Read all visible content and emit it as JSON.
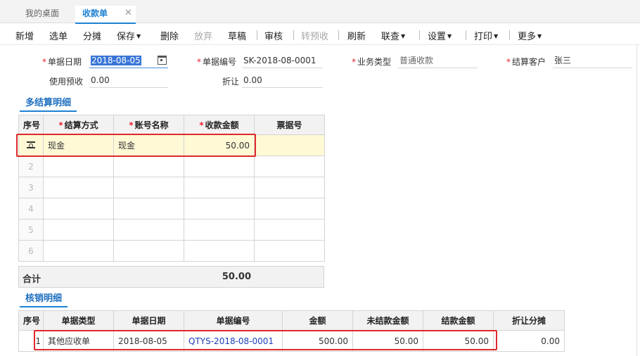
{
  "tabs": [
    {
      "label": "我的桌面"
    },
    {
      "label": "收款单",
      "close": "✕"
    }
  ],
  "toolbar": {
    "new": "新增",
    "select": "选单",
    "split": "分摊",
    "save": "保存",
    "delete": "删除",
    "abandon": "放弃",
    "draft": "草稿",
    "audit": "审核",
    "to_prepaid": "转预收",
    "refresh": "刷新",
    "link_query": "联查",
    "settings": "设置",
    "print": "打印",
    "more": "更多"
  },
  "form": {
    "date_label": "单据日期",
    "date_value": "2018-08-05",
    "doc_no_label": "单据编号",
    "doc_no_value": "SK-2018-08-0001",
    "biz_type_label": "业务类型",
    "biz_type_value": "普通收款",
    "customer_label": "结算客户",
    "customer_value": "张三",
    "use_prepaid_label": "使用预收",
    "use_prepaid_value": "0.00",
    "discount_label": "折让",
    "discount_value": "0.00"
  },
  "settlement": {
    "title": "多结算明细",
    "headers": [
      "序号",
      "结算方式",
      "账号名称",
      "收款金额",
      "票据号"
    ],
    "rows": [
      {
        "method": "现金",
        "account": "现金",
        "amount": "50.00",
        "ticket": ""
      }
    ],
    "empty_rows": [
      "2",
      "3",
      "4",
      "5",
      "6"
    ],
    "total_label": "合计",
    "total_value": "50.00"
  },
  "verify": {
    "title": "核销明细",
    "headers": [
      "序号",
      "单据类型",
      "单据日期",
      "单据编号",
      "金额",
      "未结款金额",
      "结款金额",
      "折让分摊"
    ],
    "rows": [
      {
        "idx": "1",
        "type": "其他应收单",
        "date": "2018-08-05",
        "no": "QTYS-2018-08-0001",
        "amount": "500.00",
        "unpaid": "50.00",
        "paid": "50.00",
        "discount": "0.00"
      }
    ]
  },
  "colors": {
    "accent": "#1e82d2",
    "highlight_box": "#e0292a",
    "selected_row": "#fff9d6"
  }
}
